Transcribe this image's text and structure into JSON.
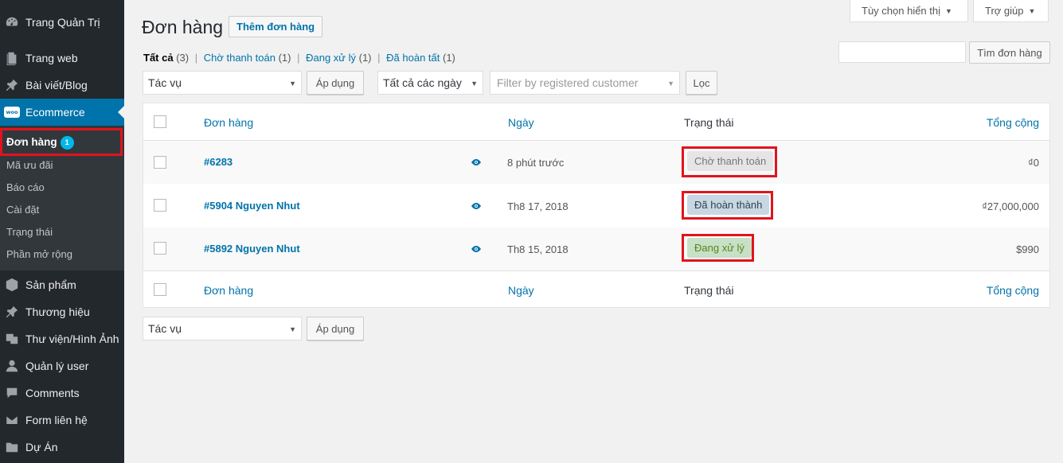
{
  "sidebar": {
    "items": [
      {
        "label": "Trang Quản Trị",
        "icon": "dashboard-icon"
      },
      {
        "label": "Trang web",
        "icon": "pages-icon"
      },
      {
        "label": "Bài viết/Blog",
        "icon": "pin-icon"
      },
      {
        "label": "Ecommerce",
        "icon": "woocommerce-icon"
      },
      {
        "label": "Sản phẩm",
        "icon": "product-icon"
      },
      {
        "label": "Thương hiệu",
        "icon": "pin-icon"
      },
      {
        "label": "Thư viện/Hình Ảnh",
        "icon": "media-icon"
      },
      {
        "label": "Quản lý user",
        "icon": "user-icon"
      },
      {
        "label": "Comments",
        "icon": "comment-icon"
      },
      {
        "label": "Form liên hệ",
        "icon": "mail-icon"
      },
      {
        "label": "Dự Án",
        "icon": "folder-icon"
      }
    ],
    "woo_logo": "woo",
    "submenu": [
      {
        "label": "Đơn hàng",
        "count": "1"
      },
      {
        "label": "Mã ưu đãi"
      },
      {
        "label": "Báo cáo"
      },
      {
        "label": "Cài đặt"
      },
      {
        "label": "Trạng thái"
      },
      {
        "label": "Phần mở rộng"
      }
    ]
  },
  "header": {
    "screen_options": "Tùy chọn hiển thị",
    "help": "Trợ giúp",
    "title": "Đơn hàng",
    "add_new": "Thêm đơn hàng"
  },
  "filters": {
    "all": {
      "label": "Tất cả",
      "count": "(3)"
    },
    "pending": {
      "label": "Chờ thanh toán",
      "count": "(1)"
    },
    "processing": {
      "label": "Đang xử lý",
      "count": "(1)"
    },
    "completed": {
      "label": "Đã hoàn tất",
      "count": "(1)"
    },
    "separator": "|"
  },
  "search": {
    "button": "Tìm đơn hàng",
    "value": ""
  },
  "tablenav": {
    "bulk_action": "Tác vụ",
    "apply": "Áp dụng",
    "date_filter": "Tất cả các ngày",
    "customer_filter_placeholder": "Filter by registered customer",
    "filter_button": "Lọc"
  },
  "table": {
    "columns": {
      "order": "Đơn hàng",
      "date": "Ngày",
      "status": "Trạng thái",
      "total": "Tổng cộng"
    },
    "rows": [
      {
        "order": "#6283",
        "date": "8 phút trước",
        "status": "Chờ thanh toán",
        "total": "₫0"
      },
      {
        "order": "#5904 Nguyen Nhut",
        "date": "Th8 17, 2018",
        "status": "Đã hoàn thành",
        "total": "₫27,000,000"
      },
      {
        "order": "#5892 Nguyen Nhut",
        "date": "Th8 15, 2018",
        "status": "Đang xử lý",
        "total": "$990"
      }
    ]
  },
  "colors": {
    "sidebar_bg": "#23282d",
    "accent": "#0073aa",
    "highlight_border": "#e0141e",
    "status_pending_bg": "#e5e5e5",
    "status_completed_bg": "#c8d7e1",
    "status_processing_bg": "#c6e1c6"
  }
}
